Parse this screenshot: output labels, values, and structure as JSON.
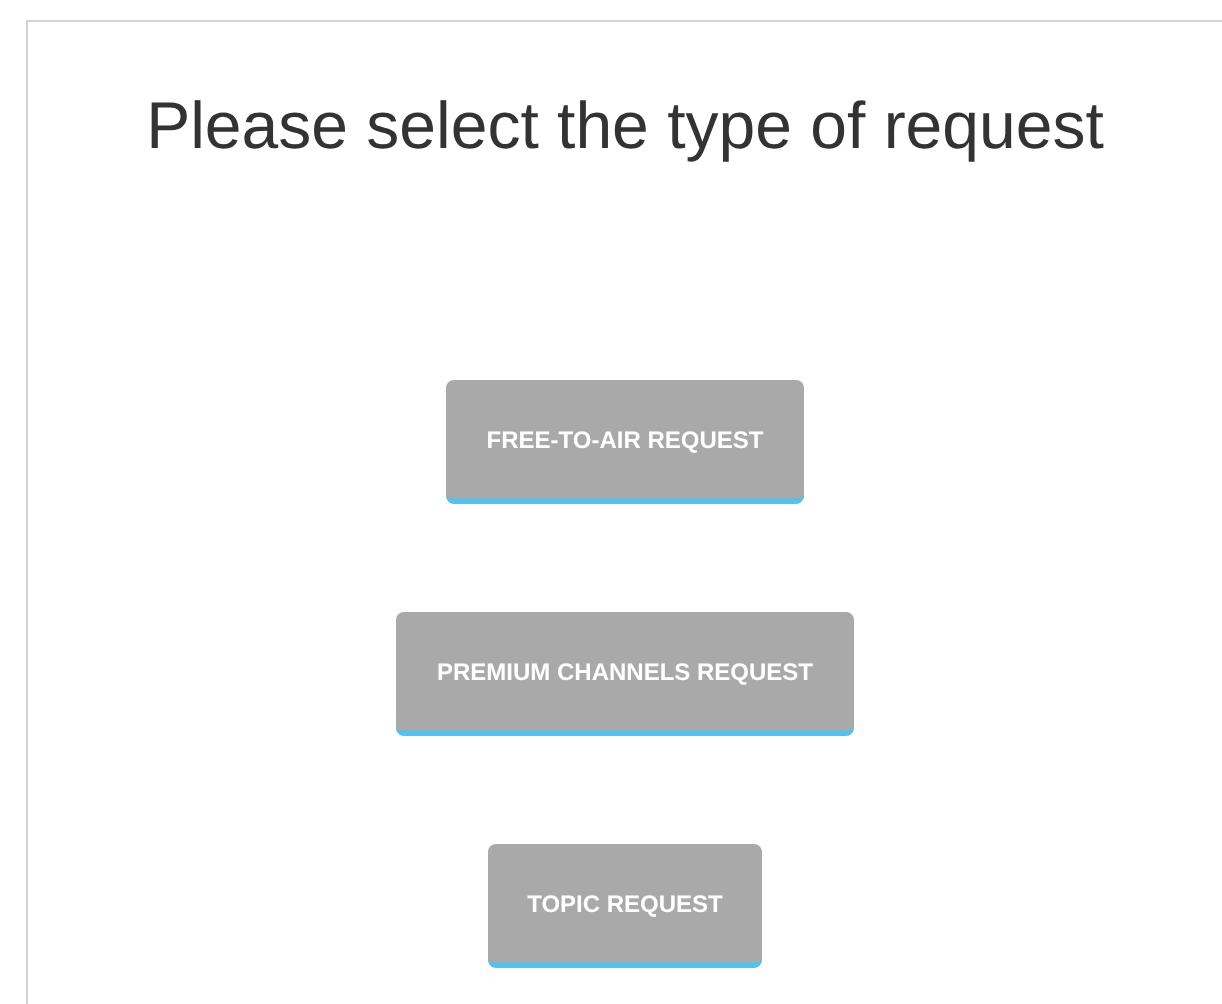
{
  "title": "Please select the type of request",
  "buttons": [
    {
      "label": "FREE-TO-AIR REQUEST"
    },
    {
      "label": "PREMIUM CHANNELS REQUEST"
    },
    {
      "label": "TOPIC REQUEST"
    }
  ]
}
